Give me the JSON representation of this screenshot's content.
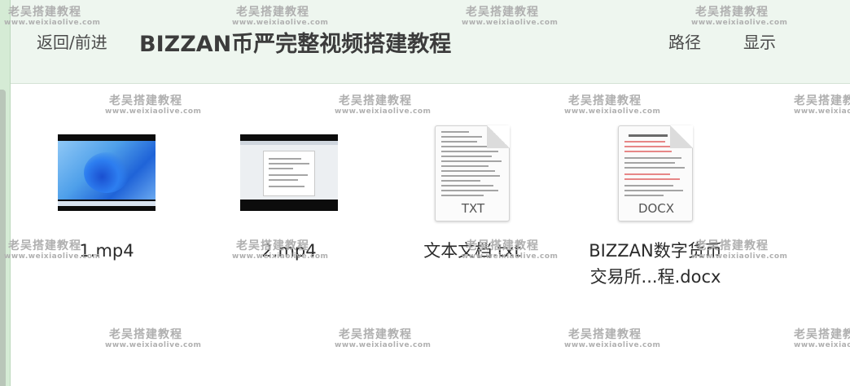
{
  "toolbar": {
    "back_forward": "返回/前进",
    "title": "BIZZAN币严完整视频搭建教程",
    "path": "路径",
    "show": "显示"
  },
  "files": [
    {
      "name": "1.mp4",
      "kind": "video"
    },
    {
      "name": "2.mp4",
      "kind": "video"
    },
    {
      "name": "文本文档.txt",
      "kind": "text",
      "badge": "TXT"
    },
    {
      "name_line1": "BIZZAN数字货币",
      "name_line2": "交易所...程.docx",
      "kind": "docx",
      "badge": "DOCX"
    }
  ],
  "watermark": {
    "cn": "老吴搭建教程",
    "en": "www.weixiaolive.com"
  },
  "colors": {
    "toolbar_bg": "#eef6ef",
    "sidebar_strip": "#d5ebd5",
    "watermark": "#b0b0b0"
  }
}
